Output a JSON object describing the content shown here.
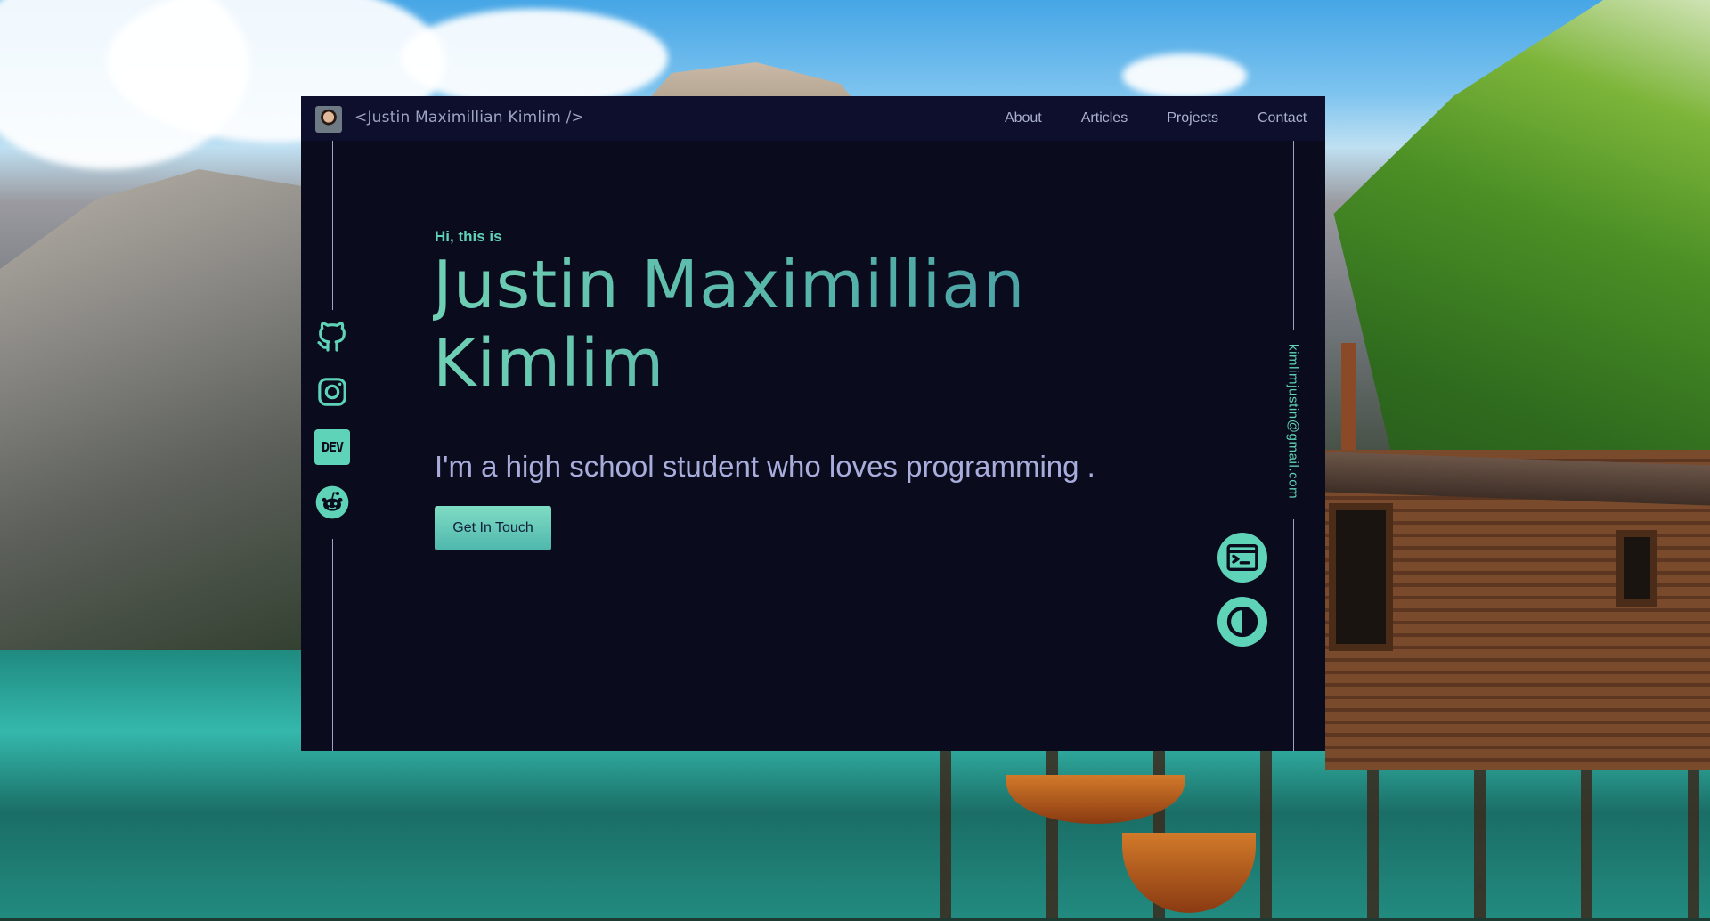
{
  "site": {
    "logo_text": "<Justin Maximillian Kimlim />",
    "nav": [
      "About",
      "Articles",
      "Projects",
      "Contact"
    ],
    "hero": {
      "greeting": "Hi, this is",
      "name_line1": "Justin Maximillian",
      "name_line2": "Kimlim",
      "tagline": "I'm a high school student who loves programming .",
      "cta": "Get In Touch"
    },
    "socials": {
      "github": "github-icon",
      "instagram": "instagram-icon",
      "dev": "DEV",
      "reddit": "reddit-icon"
    },
    "email": "kimlimjustin@gmail.com",
    "floating_buttons": [
      "terminal-icon",
      "theme-toggle-icon"
    ]
  },
  "colors": {
    "accent": "#5fd3b8",
    "background": "#0a0b1d",
    "navbar": "#0e0f2c",
    "text_muted": "#a9addc"
  }
}
